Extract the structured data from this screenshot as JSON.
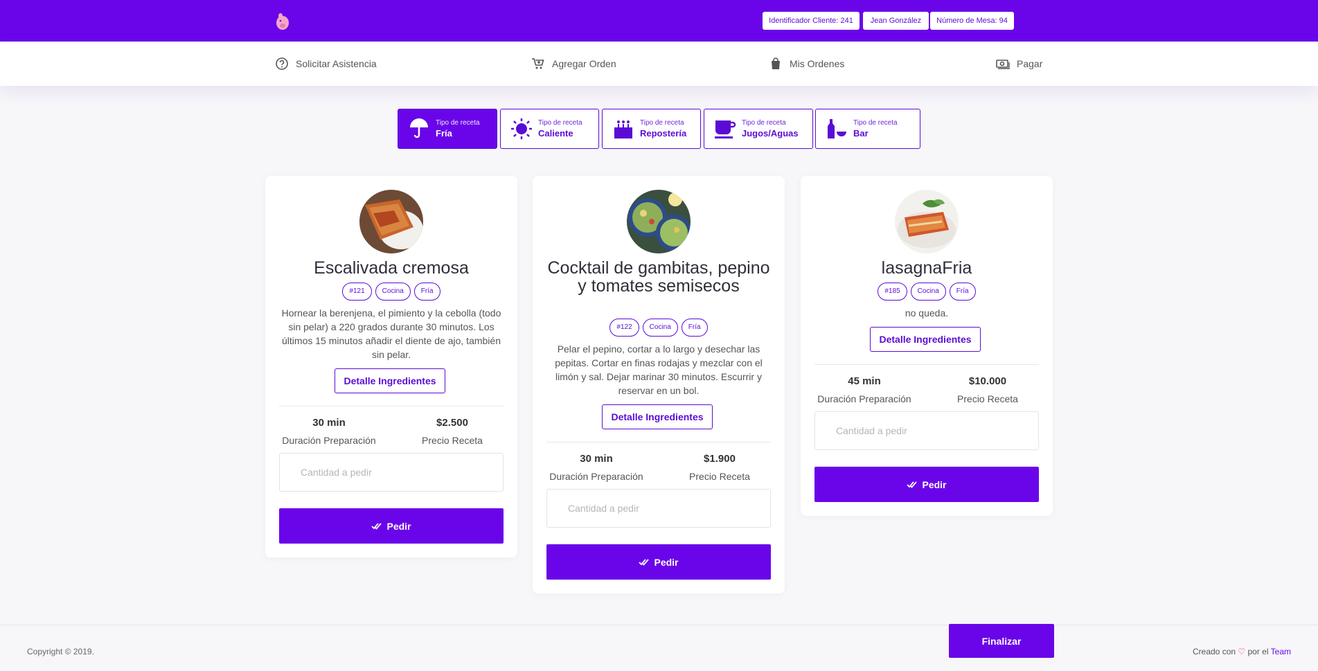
{
  "header": {
    "client_id": "Identificador Cliente: 241",
    "user_name": "Jean González",
    "table_number": "Número de Mesa: 94"
  },
  "nav": {
    "assist": "Solicitar Asistencia",
    "add_order": "Agregar Orden",
    "my_orders": "Mis Ordenes",
    "pay": "Pagar"
  },
  "tabs": [
    {
      "small": "Tipo de receta",
      "label": "Fría",
      "icon": "umbrella-icon"
    },
    {
      "small": "Tipo de receta",
      "label": "Caliente",
      "icon": "sun-icon"
    },
    {
      "small": "Tipo de receta",
      "label": "Repostería",
      "icon": "cake-icon"
    },
    {
      "small": "Tipo de receta",
      "label": "Jugos/Aguas",
      "icon": "cup-icon"
    },
    {
      "small": "Tipo de receta",
      "label": "Bar",
      "icon": "bottle-icon"
    }
  ],
  "cards": [
    {
      "title": "Escalivada cremosa",
      "tags": [
        "#121",
        "Cocina",
        "Fría"
      ],
      "description": "Hornear la berenjena, el pimiento y la cebolla (todo sin pelar) a 220 grados durante 30 minutos. Los últimos 15 minutos añadir el diente de ajo, también sin pelar.",
      "detail_label": "Detalle Ingredientes",
      "duration": "30 min",
      "duration_label": "Duración Preparación",
      "price": "$2.500",
      "price_label": "Precio Receta",
      "qty_placeholder": "Cantidad a pedir",
      "order_label": "Pedir"
    },
    {
      "title": "Cocktail de gambitas, pepino y tomates semisecos",
      "tags": [
        "#122",
        "Cocina",
        "Fría"
      ],
      "description": "Pelar el pepino, cortar a lo largo y desechar las pepitas. Cortar en finas rodajas y mezclar con el limón y sal. Dejar marinar 30 minutos. Escurrir y reservar en un bol.",
      "detail_label": "Detalle Ingredientes",
      "duration": "30 min",
      "duration_label": "Duración Preparación",
      "price": "$1.900",
      "price_label": "Precio Receta",
      "qty_placeholder": "Cantidad a pedir",
      "order_label": "Pedir"
    },
    {
      "title": "lasagnaFria",
      "tags": [
        "#185",
        "Cocina",
        "Fría"
      ],
      "description": "no queda.",
      "detail_label": "Detalle Ingredientes",
      "duration": "45 min",
      "duration_label": "Duración Preparación",
      "price": "$10.000",
      "price_label": "Precio Receta",
      "qty_placeholder": "Cantidad a pedir",
      "order_label": "Pedir"
    }
  ],
  "footer": {
    "copyright": "Copyright © 2019.",
    "finalize": "Finalizar",
    "credits_prefix": "Creado con",
    "credits_mid": "por el",
    "credits_team": "Team"
  },
  "colors": {
    "primary": "#6a05ea",
    "background": "#f7f6f9",
    "heart": "#e91e63"
  }
}
